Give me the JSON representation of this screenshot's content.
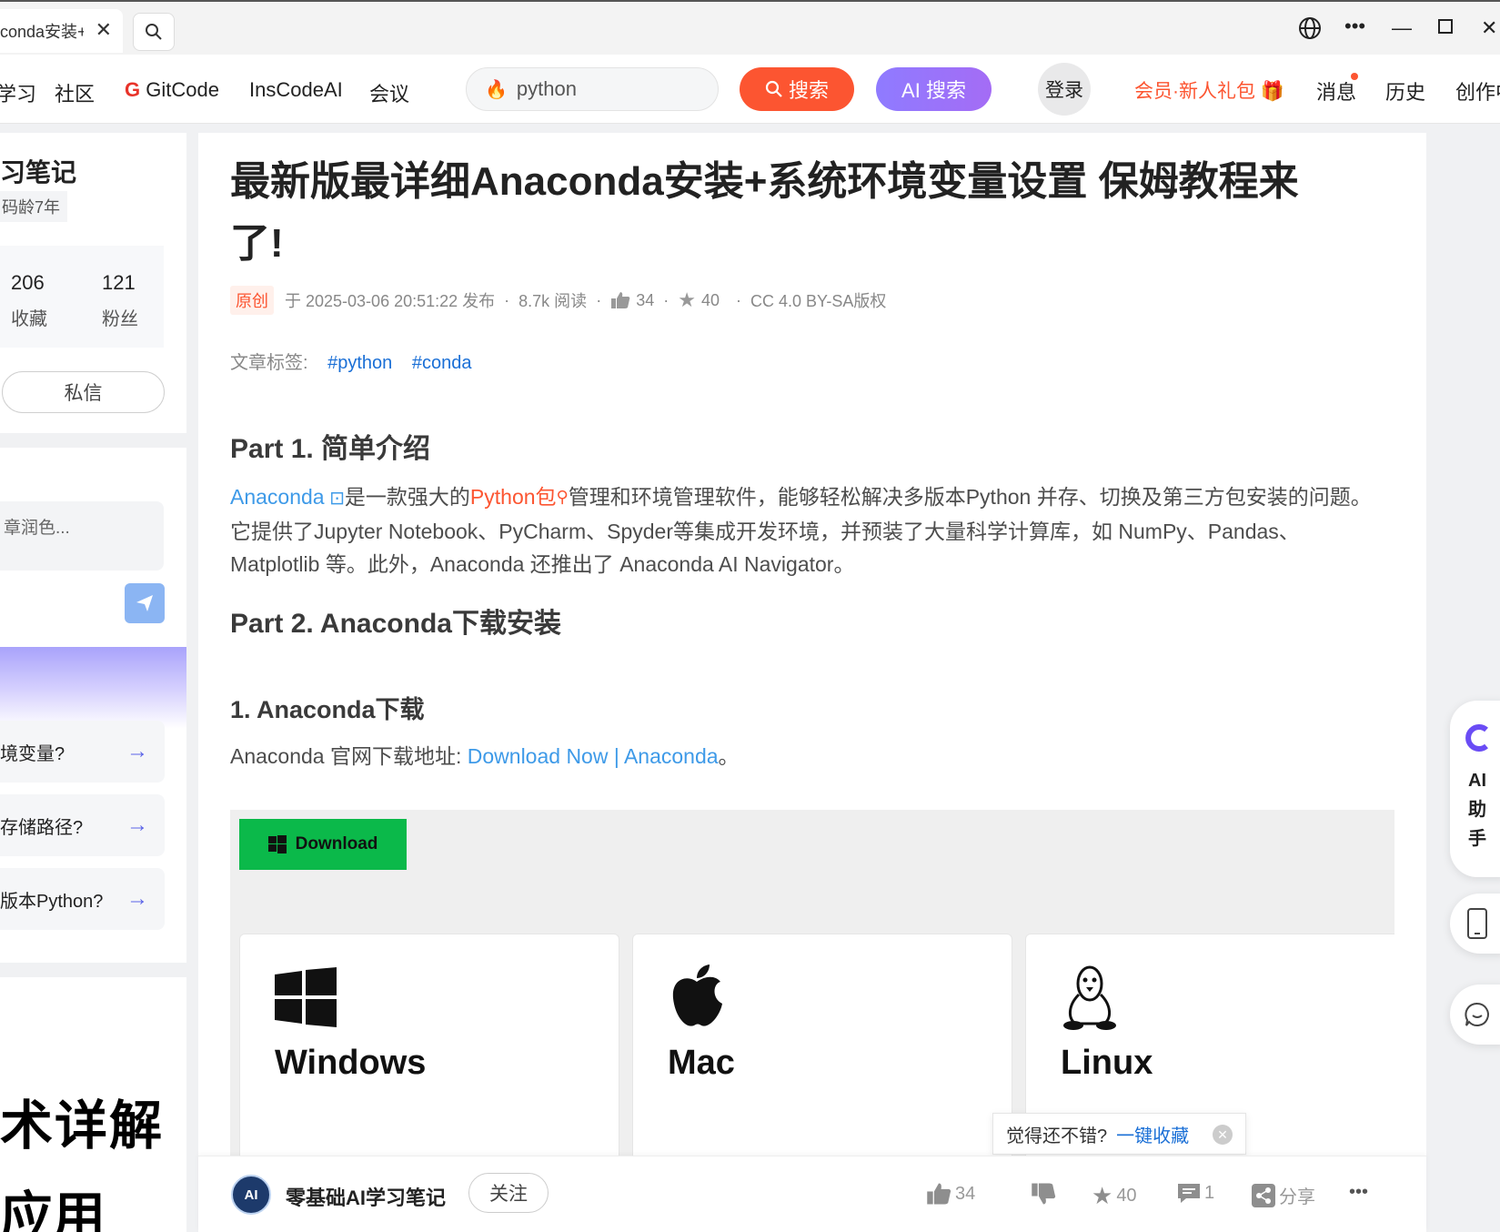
{
  "browser": {
    "tab_title": "conda安装+",
    "tab_close": "✕"
  },
  "nav": {
    "items": [
      "学习",
      "社区",
      "GitCode",
      "InsCodeAI",
      "会议"
    ],
    "gitcode_prefix": "G",
    "search_value": "python",
    "search_button": "搜索",
    "ai_search_button": "AI 搜索",
    "login": "登录",
    "vip": "会员·新人礼包",
    "links": [
      "消息",
      "历史",
      "创作中"
    ]
  },
  "sidebar": {
    "author_name": "习笔记",
    "author_badge": "码龄7年",
    "stats": [
      {
        "value": "206",
        "label": "收藏"
      },
      {
        "value": "121",
        "label": "粉丝"
      }
    ],
    "dm_button": "私信",
    "ai_input_placeholder": "章润色...",
    "questions": [
      "境变量?",
      "存储路径?",
      "版本Python?"
    ],
    "promo_line1": "术详解",
    "promo_line2": "应用"
  },
  "article": {
    "title": "最新版最详细Anaconda安装+系统环境变量设置 保姆教程来了!",
    "meta": {
      "original_tag": "原创",
      "published": "于 2025-03-06 20:51:22 发布",
      "reads": "8.7k 阅读",
      "likes": "34",
      "favorites": "40",
      "license": "CC 4.0 BY-SA版权"
    },
    "tags_label": "文章标签:",
    "tags": [
      "#python",
      "#conda"
    ],
    "part1_heading": "Part 1. 简单介绍",
    "part1_link1": "Anaconda",
    "part1_text1": "是一款强大的",
    "part1_link2": "Python包",
    "part1_text2": "管理和环境管理软件，能够轻松解决多版本Python 并存、切换及第三方包安装的问题。它提供了Jupyter Notebook、PyCharm、Spyder等集成开发环境，并预装了大量科学计算库，如 NumPy、Pandas、Matplotlib 等。此外，Anaconda 还推出了 Anaconda AI Navigator。",
    "part2_heading": "Part 2. Anaconda下载安装",
    "sub_heading": "1. Anaconda下载",
    "download_prefix": "Anaconda 官网下载地址:",
    "download_link": "Download Now | Anaconda",
    "download_suffix": "。",
    "screenshot": {
      "download_button": "Download",
      "os_cards": [
        "Windows",
        "Mac",
        "Linux"
      ]
    }
  },
  "bottom_bar": {
    "avatar_text": "AI",
    "author": "零基础AI学习笔记",
    "follow": "关注",
    "likes": "34",
    "favorites": "40",
    "comments": "1",
    "share": "分享",
    "more": "•••"
  },
  "toast": {
    "text": "觉得还不错?",
    "link": "一键收藏"
  },
  "right_rail": {
    "ai_label": "AI助手"
  },
  "colors": {
    "brand_red": "#fc5531",
    "link_blue": "#3e9ae8",
    "ai_purple": "#8f7bff",
    "download_green": "#0bb94a"
  }
}
